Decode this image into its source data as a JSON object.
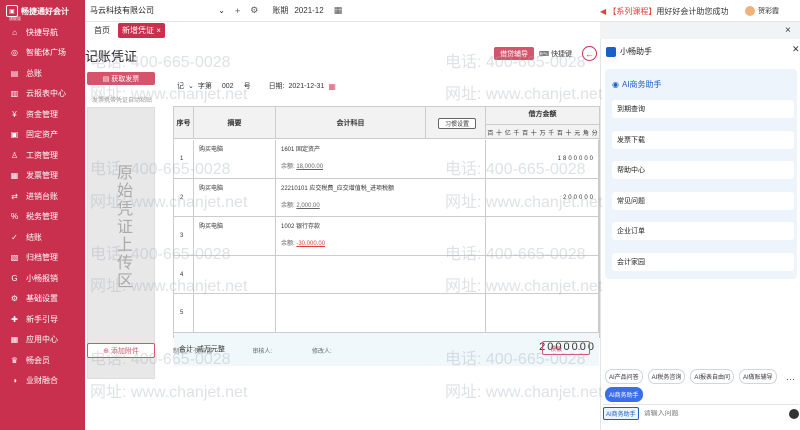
{
  "brand": {
    "name": "畅捷通好会计",
    "edition": "旗舰版"
  },
  "sidebar": {
    "items": [
      {
        "label": "快捷导航",
        "icon": "home-icon"
      },
      {
        "label": "智能体广场",
        "icon": "ai-icon"
      },
      {
        "label": "总账",
        "icon": "ledger-icon"
      },
      {
        "label": "云报表中心",
        "icon": "chart-icon"
      },
      {
        "label": "资金管理",
        "icon": "money-icon"
      },
      {
        "label": "固定资产",
        "icon": "asset-icon"
      },
      {
        "label": "工资管理",
        "icon": "salary-icon"
      },
      {
        "label": "发票管理",
        "icon": "invoice-icon"
      },
      {
        "label": "进销台账",
        "icon": "trade-icon"
      },
      {
        "label": "税务管理",
        "icon": "tax-icon"
      },
      {
        "label": "结账",
        "icon": "close-books-icon"
      },
      {
        "label": "归档管理",
        "icon": "archive-icon"
      },
      {
        "label": "小畅报销",
        "icon": "reimburse-icon"
      },
      {
        "label": "基础设置",
        "icon": "settings-icon"
      },
      {
        "label": "新手引导",
        "icon": "guide-icon"
      },
      {
        "label": "应用中心",
        "icon": "apps-icon"
      },
      {
        "label": "畅会员",
        "icon": "member-icon"
      },
      {
        "label": "业财融合",
        "icon": "fusion-icon"
      }
    ]
  },
  "topbar": {
    "company": "马云科技有限公司",
    "period_label": "账期",
    "period_value": "2021-12",
    "notice_tag": "【系列课程】",
    "notice_text": "用好好会计助您成功",
    "user_name": "贺彩霞"
  },
  "tabs": [
    {
      "label": "首页",
      "active": false
    },
    {
      "label": "新增凭证",
      "active": true
    }
  ],
  "page": {
    "title": "记账凭证",
    "aux_button": "借贷辅导",
    "quick_key": "快捷键"
  },
  "upload": {
    "button": "获取发票",
    "hint": "发票携带凭证自动粘贴",
    "area_text": "原始凭证上传区",
    "attach_button": "添加附件"
  },
  "voucher": {
    "type": "记",
    "word_label": "字第",
    "number": "002",
    "number_suffix": "号",
    "date_label": "日期:",
    "date": "2021-12-31",
    "headers": {
      "no": "序号",
      "desc": "摘要",
      "account": "会计科目",
      "habit_button": "习惯设置",
      "debit": "借方金额"
    },
    "digits": [
      "百",
      "十",
      "亿",
      "千",
      "百",
      "十",
      "万",
      "千",
      "百",
      "十",
      "元",
      "角",
      "分"
    ],
    "balance_label": "余额:",
    "rows": [
      {
        "no": "1",
        "desc": "购买电脑",
        "account": "1601 固定资产",
        "balance": "18,000.00",
        "negative": false,
        "debit": "1800000"
      },
      {
        "no": "2",
        "desc": "购买电脑",
        "account": "22210101 应交税费_应交增值税_进项税额",
        "balance": "2,000.00",
        "negative": false,
        "debit": "200000"
      },
      {
        "no": "3",
        "desc": "购买电脑",
        "account": "1002 银行存款",
        "balance": "-30,000.00",
        "negative": true,
        "debit": ""
      },
      {
        "no": "4",
        "desc": "",
        "account": "",
        "balance": "",
        "negative": false,
        "debit": ""
      },
      {
        "no": "5",
        "desc": "",
        "account": "",
        "balance": "",
        "negative": false,
        "debit": ""
      }
    ],
    "total_label": "合计: 贰万元整",
    "total_amount": "2000000"
  },
  "footer": {
    "maker": "制单人: 贺彩霞",
    "reviewer": "审核人:",
    "modifier": "修改人:",
    "template_button": "模板"
  },
  "ai": {
    "title": "小畅助手",
    "card_title": "AI商务助手",
    "options": [
      "到期查询",
      "发票下载",
      "帮助中心",
      "常见问题",
      "企业订单",
      "会计家园"
    ],
    "chips": [
      {
        "label": "AI产品问答",
        "active": false
      },
      {
        "label": "AI税务咨询",
        "active": false
      },
      {
        "label": "AI报表自由问",
        "active": false
      },
      {
        "label": "AI做账辅导",
        "active": false
      },
      {
        "label": "AI商务助手",
        "active": true
      }
    ],
    "input_tag": "AI商务助手",
    "input_placeholder": "请输入问题"
  },
  "watermark": {
    "phone": "电话: 400-665-0028",
    "site": "网址: www.chanjet.net"
  }
}
